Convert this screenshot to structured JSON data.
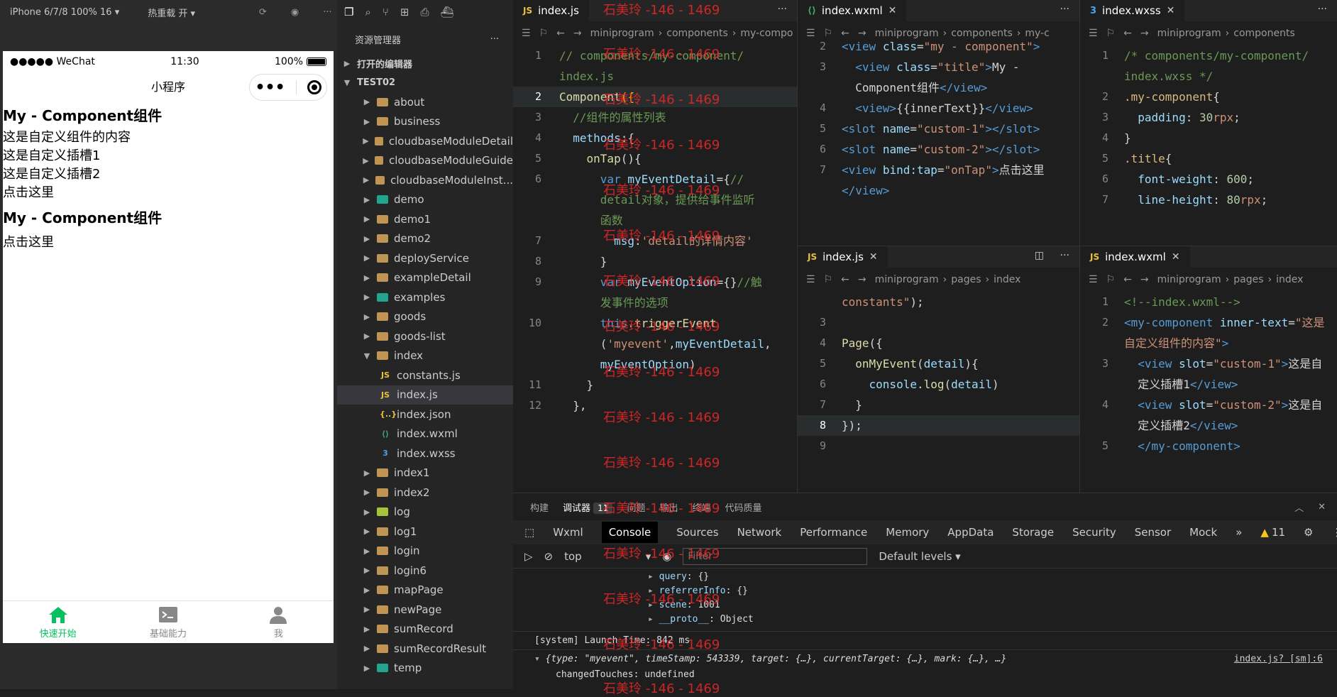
{
  "simulator": {
    "device": "iPhone 6/7/8 100% 16 ▾",
    "hot_reload": "热重载 开 ▾",
    "status": {
      "carrier": "●●●●● WeChat",
      "time": "11:30",
      "battery": "100%"
    },
    "nav_title": "小程序",
    "page": {
      "heading1": "My - Component组件",
      "inner_text": "这是自定义组件的内容",
      "slot1": "这是自定义插槽1",
      "slot2": "这是自定义插槽2",
      "click1": "点击这里",
      "heading2": "My - Component组件",
      "click2": "点击这里"
    },
    "tabbar": [
      {
        "label": "快速开始",
        "icon": "home-icon"
      },
      {
        "label": "基础能力",
        "icon": "terminal-icon"
      },
      {
        "label": "我",
        "icon": "user-icon"
      }
    ]
  },
  "explorer": {
    "title": "资源管理器",
    "open_editors": "打开的编辑器",
    "project": "TEST02",
    "items": [
      {
        "label": "about",
        "type": "folder"
      },
      {
        "label": "business",
        "type": "folder"
      },
      {
        "label": "cloudbaseModuleDetail",
        "type": "folder"
      },
      {
        "label": "cloudbaseModuleGuide",
        "type": "folder"
      },
      {
        "label": "cloudbaseModuleInst...",
        "type": "folder"
      },
      {
        "label": "demo",
        "type": "folder-teal"
      },
      {
        "label": "demo1",
        "type": "folder"
      },
      {
        "label": "demo2",
        "type": "folder"
      },
      {
        "label": "deployService",
        "type": "folder"
      },
      {
        "label": "exampleDetail",
        "type": "folder"
      },
      {
        "label": "examples",
        "type": "folder-teal"
      },
      {
        "label": "goods",
        "type": "folder"
      },
      {
        "label": "goods-list",
        "type": "folder"
      },
      {
        "label": "index",
        "type": "folder-open"
      },
      {
        "label": "constants.js",
        "type": "js"
      },
      {
        "label": "index.js",
        "type": "js"
      },
      {
        "label": "index.json",
        "type": "json"
      },
      {
        "label": "index.wxml",
        "type": "wxml"
      },
      {
        "label": "index.wxss",
        "type": "wxss"
      },
      {
        "label": "index1",
        "type": "folder"
      },
      {
        "label": "index2",
        "type": "folder"
      },
      {
        "label": "log",
        "type": "folder-lime"
      },
      {
        "label": "log1",
        "type": "folder"
      },
      {
        "label": "login",
        "type": "folder"
      },
      {
        "label": "login6",
        "type": "folder"
      },
      {
        "label": "mapPage",
        "type": "folder"
      },
      {
        "label": "newPage",
        "type": "folder"
      },
      {
        "label": "sumRecord",
        "type": "folder"
      },
      {
        "label": "sumRecordResult",
        "type": "folder"
      },
      {
        "label": "temp",
        "type": "folder-teal"
      }
    ]
  },
  "editors": {
    "js": {
      "tab": "index.js",
      "crumb": [
        "miniprogram",
        "components",
        "my-compo"
      ],
      "lines": [
        {
          "n": "1",
          "html": "<span class='c-com'>// components/my-component/</span>"
        },
        {
          "n": "",
          "html": "<span class='c-com'>index.js</span>"
        },
        {
          "n": "2",
          "html": "<span class='c-fn'>Component</span><span class='c-brace'>({</span>",
          "hl": true
        },
        {
          "n": "3",
          "html": "  <span class='c-com'>//组件的属性列表</span>"
        },
        {
          "n": "4",
          "html": "  <span class='c-prop'>methods</span>:{"
        },
        {
          "n": "5",
          "html": "    <span class='c-fn'>onTap</span>(){"
        },
        {
          "n": "6",
          "html": "      <span class='c-kw'>var</span> <span class='c-prop'>myEventDetail</span>={<span class='c-com'>//</span>"
        },
        {
          "n": "",
          "html": "      <span class='c-com'>detail对象，提供给事件监听</span>"
        },
        {
          "n": "",
          "html": "      <span class='c-com'>函数</span>"
        },
        {
          "n": "7",
          "html": "        <span class='c-prop'>msg</span>:<span class='c-str'>'detail的详情内容'</span>"
        },
        {
          "n": "8",
          "html": "      }"
        },
        {
          "n": "9",
          "html": "      <span class='c-kw'>var</span> <span class='c-prop'>myEventOption</span>={}<span class='c-com'>//触</span>"
        },
        {
          "n": "",
          "html": "      <span class='c-com'>发事件的选项</span>"
        },
        {
          "n": "10",
          "html": "      <span class='c-kw'>this</span>.<span class='c-fn'>triggerEvent</span>"
        },
        {
          "n": "",
          "html": "      (<span class='c-str'>'myevent'</span>,<span class='c-prop'>myEventDetail</span>,"
        },
        {
          "n": "",
          "html": "      <span class='c-prop'>myEventOption</span>)"
        },
        {
          "n": "11",
          "html": "    }"
        },
        {
          "n": "12",
          "html": "  },"
        }
      ]
    },
    "wxml_component": {
      "tab": "index.wxml",
      "crumb": [
        "miniprogram",
        "components",
        "my-c"
      ],
      "lines": [
        {
          "n": "2",
          "html": "<span class='c-tag'>&lt;view</span> <span class='c-attr'>class</span>=<span class='c-str'>\"my - component\"</span><span class='c-tag'>&gt;</span>"
        },
        {
          "n": "3",
          "html": "  <span class='c-tag'>&lt;view</span> <span class='c-attr'>class</span>=<span class='c-str'>\"title\"</span><span class='c-tag'>&gt;</span>My -"
        },
        {
          "n": "",
          "html": "  Component组件<span class='c-tag'>&lt;/view&gt;</span>"
        },
        {
          "n": "4",
          "html": "  <span class='c-tag'>&lt;view&gt;</span>{{innerText}}<span class='c-tag'>&lt;/view&gt;</span>"
        },
        {
          "n": "5",
          "html": "<span class='c-tag'>&lt;slot</span> <span class='c-attr'>name</span>=<span class='c-str'>\"custom-1\"</span><span class='c-tag'>&gt;&lt;/slot&gt;</span>"
        },
        {
          "n": "6",
          "html": "<span class='c-tag'>&lt;slot</span> <span class='c-attr'>name</span>=<span class='c-str'>\"custom-2\"</span><span class='c-tag'>&gt;&lt;/slot&gt;</span>"
        },
        {
          "n": "7",
          "html": "<span class='c-tag'>&lt;view</span> <span class='c-attr'>bind:tap</span>=<span class='c-str'>\"onTap\"</span><span class='c-tag'>&gt;</span>点击这里"
        },
        {
          "n": "",
          "html": "<span class='c-tag'>&lt;/view&gt;</span>"
        }
      ]
    },
    "wxss": {
      "tab": "index.wxss",
      "crumb": [
        "miniprogram",
        "components"
      ],
      "lines": [
        {
          "n": "1",
          "html": "<span class='c-com'>/* components/my-component/</span>"
        },
        {
          "n": "",
          "html": "<span class='c-com'>index.wxss */</span>"
        },
        {
          "n": "2",
          "html": "<span class='c-cls'>.my-component</span>{"
        },
        {
          "n": "3",
          "html": "  <span class='c-prop'>padding</span>: <span class='c-num'>30</span><span class='c-str'>rpx</span>;"
        },
        {
          "n": "4",
          "html": "}"
        },
        {
          "n": "5",
          "html": "<span class='c-cls'>.title</span>{"
        },
        {
          "n": "6",
          "html": "  <span class='c-prop'>font-weight</span>: <span class='c-num'>600</span>;"
        },
        {
          "n": "7",
          "html": "  <span class='c-prop'>line-height</span>: <span class='c-num'>80</span><span class='c-str'>rpx</span>;"
        }
      ]
    },
    "js_page": {
      "tab": "index.js",
      "crumb": [
        "miniprogram",
        "pages",
        "index"
      ],
      "lines": [
        {
          "n": "",
          "html": "<span class='c-str'>constants\"</span>);"
        },
        {
          "n": "3",
          "html": ""
        },
        {
          "n": "4",
          "html": "<span class='c-fn'>Page</span>({"
        },
        {
          "n": "5",
          "html": "  <span class='c-fn'>onMyEvent</span>(<span class='c-prop'>detail</span>){"
        },
        {
          "n": "6",
          "html": "    <span class='c-prop'>console</span>.<span class='c-fn'>log</span>(<span class='c-prop'>detail</span>)"
        },
        {
          "n": "7",
          "html": "  }"
        },
        {
          "n": "8",
          "html": "});",
          "hl": true
        },
        {
          "n": "9",
          "html": ""
        }
      ]
    },
    "wxml_page": {
      "tab": "index.wxml",
      "crumb": [
        "miniprogram",
        "pages",
        "index"
      ],
      "lines": [
        {
          "n": "1",
          "html": "<span class='c-com'>&lt;!--index.wxml--&gt;</span>"
        },
        {
          "n": "2",
          "html": "<span class='c-tag'>&lt;my-component</span> <span class='c-attr'>inner-text</span>=<span class='c-str'>\"这是</span>"
        },
        {
          "n": "",
          "html": "<span class='c-str'>自定义组件的内容\"</span><span class='c-tag'>&gt;</span>"
        },
        {
          "n": "3",
          "html": "  <span class='c-tag'>&lt;view</span> <span class='c-attr'>slot</span>=<span class='c-str'>\"custom-1\"</span><span class='c-tag'>&gt;</span>这是自"
        },
        {
          "n": "",
          "html": "  定义插槽1<span class='c-tag'>&lt;/view&gt;</span>"
        },
        {
          "n": "4",
          "html": "  <span class='c-tag'>&lt;view</span> <span class='c-attr'>slot</span>=<span class='c-str'>\"custom-2\"</span><span class='c-tag'>&gt;</span>这是自"
        },
        {
          "n": "",
          "html": "  定义插槽2<span class='c-tag'>&lt;/view&gt;</span>"
        },
        {
          "n": "5",
          "html": "  <span class='c-tag'>&lt;/my-component&gt;</span>"
        }
      ]
    }
  },
  "watermark": "石美玲 -146 - 1469",
  "debugger": {
    "tabs": [
      "构建",
      "调试器",
      "问题",
      "输出",
      "终端",
      "代码质量"
    ],
    "badge": "11",
    "devtools": [
      "Wxml",
      "Console",
      "Sources",
      "Network",
      "Performance",
      "Memory",
      "AppData",
      "Storage",
      "Security",
      "Sensor",
      "Mock"
    ],
    "warn_count": "11",
    "context": "top",
    "filter_placeholder": "Filter",
    "levels": "Default levels ▾",
    "console_lines": [
      {
        "html": "<span class='k'>query</span>: {}"
      },
      {
        "html": "<span class='k'>referrerInfo</span>: {}"
      },
      {
        "html": "<span class='k'>scene</span>: 1001"
      },
      {
        "html": "<span class='k'>__proto__</span>: Object"
      }
    ],
    "system_line": "[system] Launch Time: 842 ms",
    "event_line": "{type: \"myevent\", timeStamp: 543339, target: {…}, currentTarget: {…}, mark: {…}, …}",
    "source_link": "index.js? [sm]:6",
    "changed_touches": "changedTouches: undefined"
  }
}
